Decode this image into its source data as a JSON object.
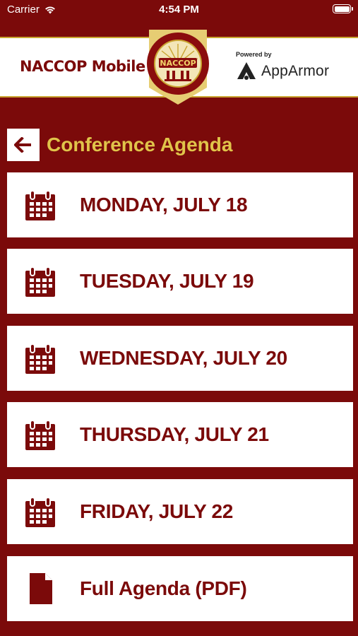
{
  "status_bar": {
    "carrier": "Carrier",
    "time": "4:54 PM"
  },
  "header": {
    "app_title": "NACCOP Mobile",
    "logo_text": "NACCOP",
    "powered_by": "Powered by",
    "partner_name": "AppArmor"
  },
  "page": {
    "title": "Conference Agenda"
  },
  "agenda": {
    "items": [
      {
        "label": "MONDAY, JULY 18",
        "icon": "calendar-icon"
      },
      {
        "label": "TUESDAY, JULY 19",
        "icon": "calendar-icon"
      },
      {
        "label": "WEDNESDAY, JULY 20",
        "icon": "calendar-icon"
      },
      {
        "label": "THURSDAY, JULY 21",
        "icon": "calendar-icon"
      },
      {
        "label": "FRIDAY, JULY 22",
        "icon": "calendar-icon"
      },
      {
        "label": "Full Agenda (PDF)",
        "icon": "document-icon"
      }
    ]
  },
  "colors": {
    "background": "#7b0a0a",
    "accent_gold": "#e0c44a",
    "card": "#ffffff"
  }
}
